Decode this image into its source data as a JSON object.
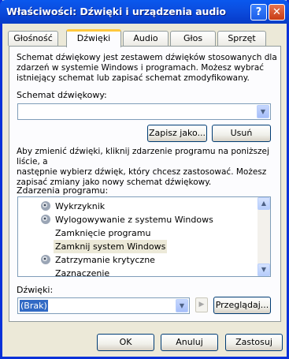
{
  "window": {
    "title": "Właściwości: Dźwięki i urządzenia audio",
    "help_glyph": "?",
    "close_glyph": "✕"
  },
  "tabs": [
    {
      "label": "Głośność",
      "active": false
    },
    {
      "label": "Dźwięki",
      "active": true
    },
    {
      "label": "Audio",
      "active": false
    },
    {
      "label": "Głos",
      "active": false
    },
    {
      "label": "Sprzęt",
      "active": false
    }
  ],
  "scheme": {
    "description": [
      "Schemat dźwiękowy jest zestawem dźwięków stosowanych dla",
      "zdarzeń w systemie Windows i programach. Możesz wybrać",
      "istniejący schemat lub zapisać schemat zmodyfikowany."
    ],
    "label": "Schemat dźwiękowy:",
    "value": "",
    "save_as_label": "Zapisz jako...",
    "delete_label": "Usuń"
  },
  "events": {
    "description": [
      "Aby zmienić dźwięki, kliknij zdarzenie programu na poniższej liście, a",
      "następnie wybierz dźwięk, który chcesz zastosować. Możesz",
      "zapisać zmiany jako nowy schemat dźwiękowy."
    ],
    "label": "Zdarzenia programu:",
    "items": [
      {
        "label": "Wykrzyknik",
        "has_sound": true,
        "selected": false
      },
      {
        "label": "Wylogowywanie z systemu Windows",
        "has_sound": true,
        "selected": false
      },
      {
        "label": "Zamknięcie programu",
        "has_sound": false,
        "selected": false
      },
      {
        "label": "Zamknij system Windows",
        "has_sound": false,
        "selected": true
      },
      {
        "label": "Zatrzymanie krytyczne",
        "has_sound": true,
        "selected": false
      },
      {
        "label": "Zaznaczenie",
        "has_sound": false,
        "selected": false
      }
    ]
  },
  "sounds": {
    "label": "Dźwięki:",
    "value": "(Brak)",
    "browse_label": "Przeglądaj..."
  },
  "footer": {
    "ok_label": "OK",
    "cancel_label": "Anuluj",
    "apply_label": "Zastosuj"
  },
  "colors": {
    "title_bar": "#0a58ee",
    "active_tab_accent": "#ffc83c",
    "dialog_bg": "#ece9d8",
    "selection_bg": "#316ac5"
  }
}
